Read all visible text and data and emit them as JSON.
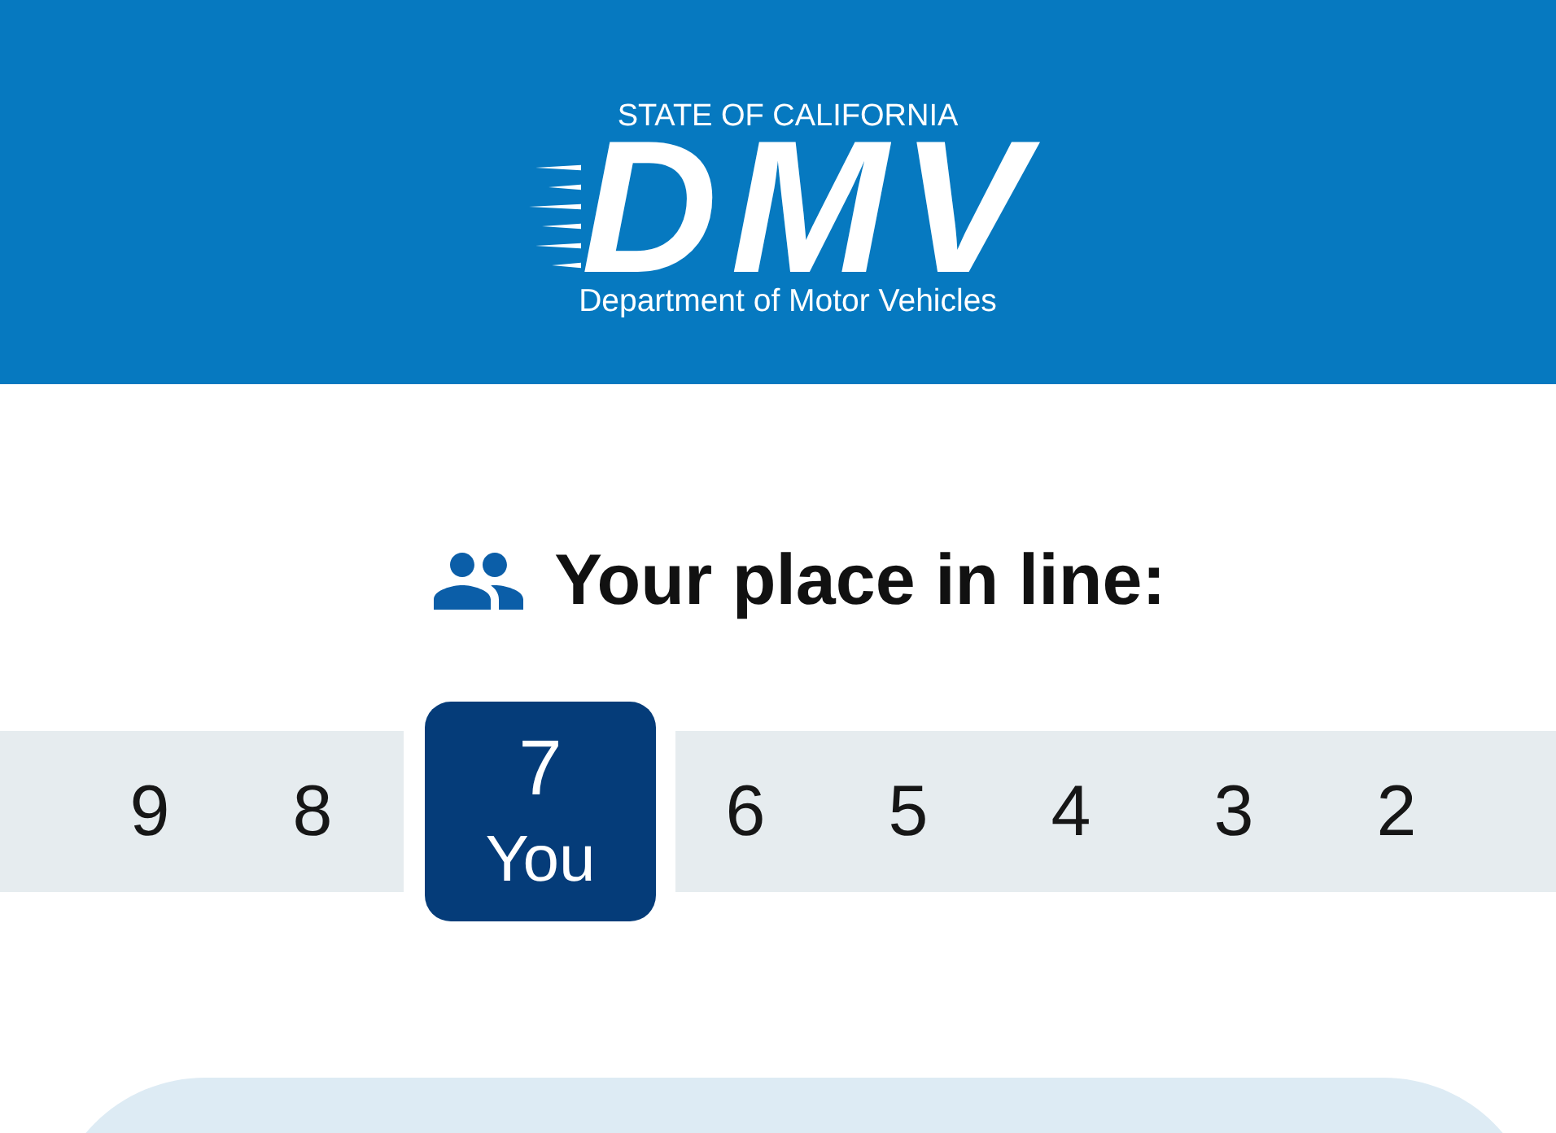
{
  "header": {
    "logo": {
      "top_line": "STATE OF CALIFORNIA",
      "wordmark": "DMV",
      "bottom_line": "Department of Motor Vehicles"
    }
  },
  "queue": {
    "title": "Your place in line:",
    "positions": [
      {
        "number": "9",
        "selected": false
      },
      {
        "number": "8",
        "selected": false
      },
      {
        "number": "7",
        "label": "You",
        "selected": true
      },
      {
        "number": "6",
        "selected": false
      },
      {
        "number": "5",
        "selected": false
      },
      {
        "number": "4",
        "selected": false
      },
      {
        "number": "3",
        "selected": false
      },
      {
        "number": "2",
        "selected": false
      }
    ]
  }
}
